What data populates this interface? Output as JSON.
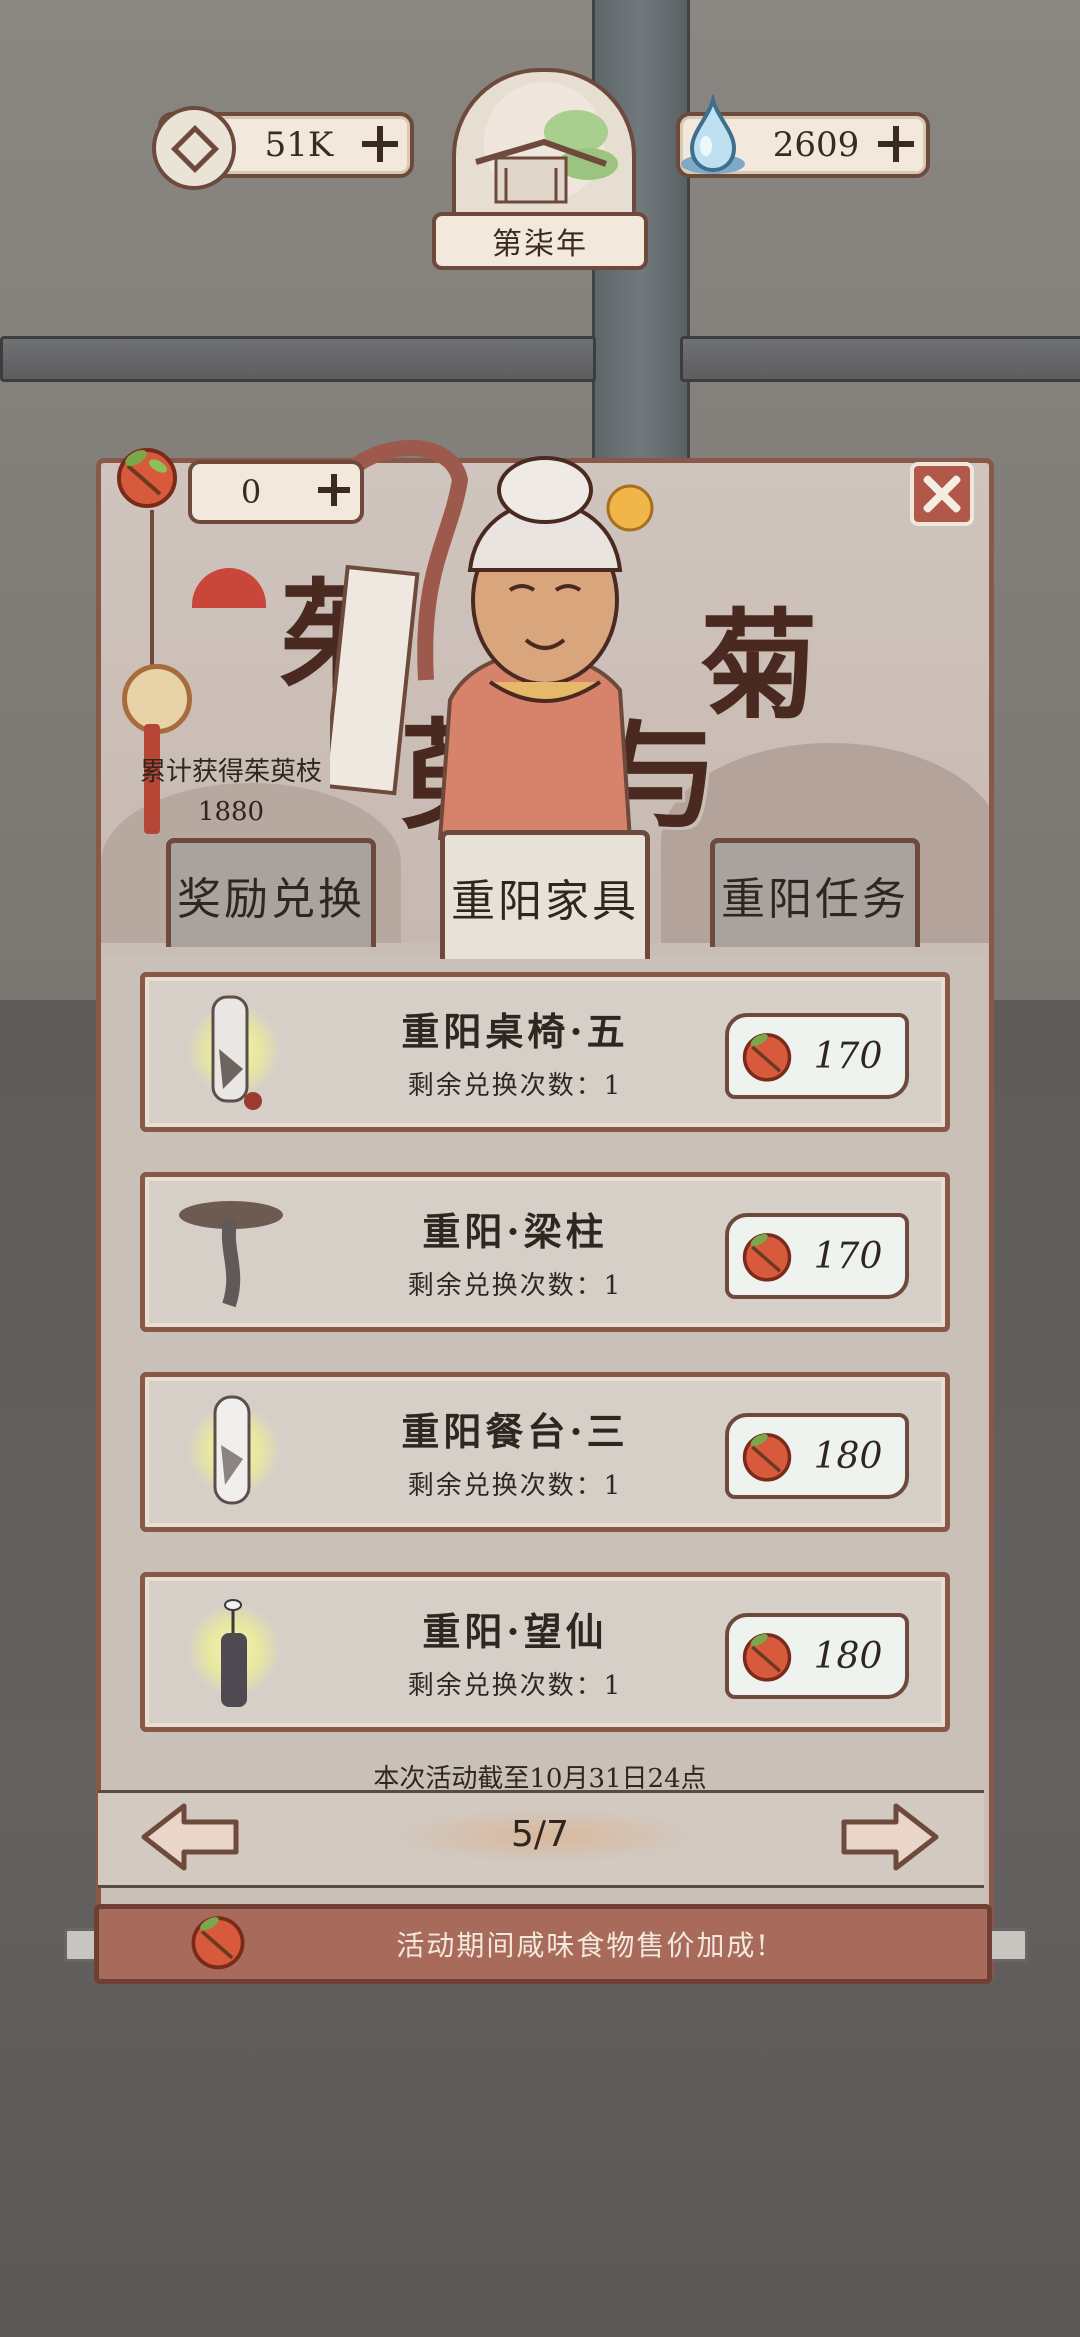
{
  "top_bar": {
    "coins": "51K",
    "year": "第柒年",
    "water": "2609"
  },
  "panel": {
    "title_chars": [
      "茱",
      "萸",
      "菊",
      "与"
    ],
    "counter_value": "0",
    "accum_label": "累计获得茱萸枝",
    "accum_value": "1880",
    "tabs": [
      {
        "label": "奖励兑换"
      },
      {
        "label": "重阳家具"
      },
      {
        "label": "重阳任务"
      }
    ],
    "items": [
      {
        "name": "重阳桌椅·五",
        "remain": "剩余兑换次数：1",
        "price": "170"
      },
      {
        "name": "重阳·梁柱",
        "remain": "剩余兑换次数：1",
        "price": "170"
      },
      {
        "name": "重阳餐台·三",
        "remain": "剩余兑换次数：1",
        "price": "180"
      },
      {
        "name": "重阳·望仙",
        "remain": "剩余兑换次数：1",
        "price": "180"
      }
    ],
    "deadline": "本次活动截至10月31日24点",
    "page": "5/7",
    "footer_text": "活动期间咸味食物售价加成!"
  },
  "colors": {
    "frame": "#8a5848",
    "accent_red": "#a86b5b",
    "paper": "#f2e9dc"
  },
  "icons": {
    "coin": "coin-icon",
    "water": "water-drop-icon",
    "fruit": "zhuyu-fruit-icon",
    "close": "close-icon",
    "prev": "arrow-left-icon",
    "next": "arrow-right-icon"
  }
}
